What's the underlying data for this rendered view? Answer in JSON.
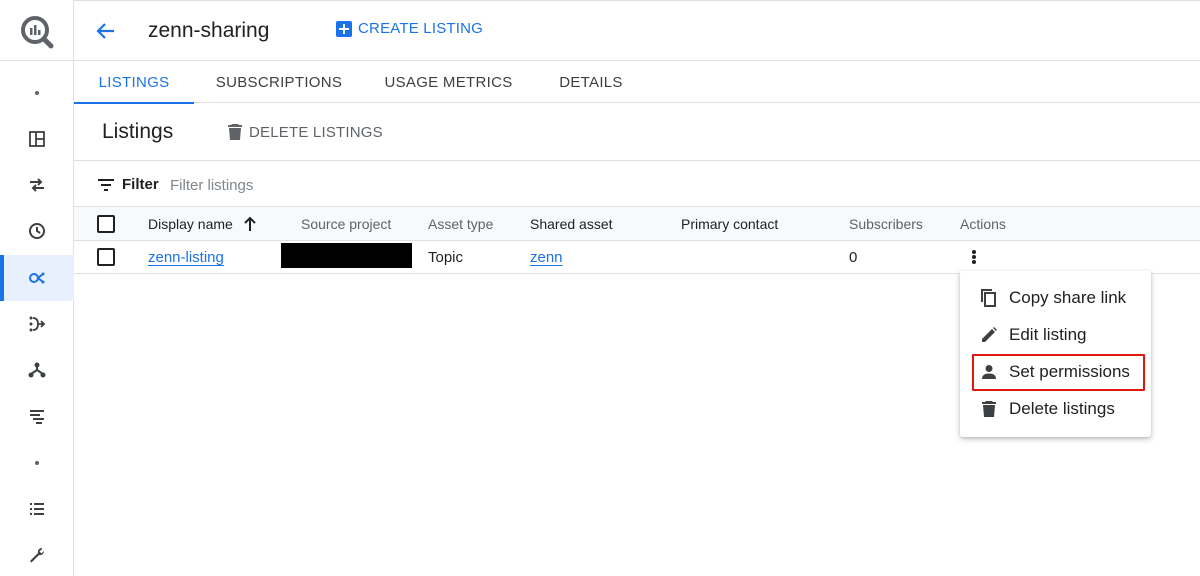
{
  "rail": {
    "items": [
      {
        "name": "rail-dot-1",
        "icon": "dot"
      },
      {
        "name": "dashboard-icon",
        "icon": "dashboard"
      },
      {
        "name": "transfers-icon",
        "icon": "swap-arrows"
      },
      {
        "name": "history-icon",
        "icon": "clock"
      },
      {
        "name": "analytics-hub-icon",
        "icon": "analytics-hub",
        "active": true
      },
      {
        "name": "dataflow-icon",
        "icon": "dataflow"
      },
      {
        "name": "hierarchy-icon",
        "icon": "hierarchy"
      },
      {
        "name": "list-filter-icon",
        "icon": "list-filter"
      },
      {
        "name": "rail-dot-2",
        "icon": "dot"
      },
      {
        "name": "list-icon",
        "icon": "list"
      },
      {
        "name": "wrench-icon",
        "icon": "wrench"
      }
    ]
  },
  "header": {
    "title": "zenn-sharing",
    "create_label": "CREATE LISTING"
  },
  "tabs": [
    {
      "label": "LISTINGS",
      "active": true
    },
    {
      "label": "SUBSCRIPTIONS",
      "active": false
    },
    {
      "label": "USAGE METRICS",
      "active": false
    },
    {
      "label": "DETAILS",
      "active": false
    }
  ],
  "listings": {
    "title": "Listings",
    "delete_label": "DELETE LISTINGS"
  },
  "filter": {
    "label": "Filter",
    "placeholder": "Filter listings"
  },
  "table": {
    "columns": [
      "Display name",
      "Source project",
      "Asset type",
      "Shared asset",
      "Primary contact",
      "Subscribers",
      "Actions"
    ],
    "rows": [
      {
        "display_name": "zenn-listing",
        "source_project": "",
        "asset_type": "Topic",
        "shared_asset": "zenn",
        "primary_contact": "",
        "subscribers": "0"
      }
    ]
  },
  "menu": {
    "items": [
      {
        "label": "Copy share link",
        "icon": "copy-icon"
      },
      {
        "label": "Edit listing",
        "icon": "pencil-icon"
      },
      {
        "label": "Set permissions",
        "icon": "person-icon",
        "highlighted": true
      },
      {
        "label": "Delete listings",
        "icon": "trash-icon"
      }
    ]
  },
  "colors": {
    "accent": "#1a73e8",
    "highlight": "#e0190f"
  }
}
